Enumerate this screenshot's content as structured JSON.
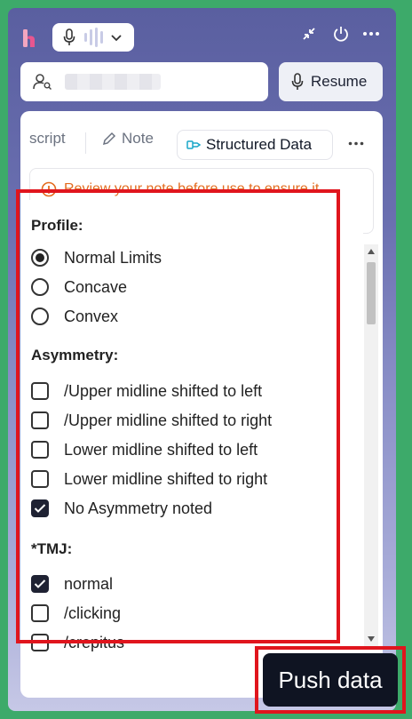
{
  "header": {
    "app_logo": "heidi-logo",
    "mic_icon": "microphone-icon",
    "collapse_icon": "collapse-icon",
    "power_icon": "power-icon",
    "more_icon": "more-horizontal-icon"
  },
  "search": {
    "user_icon": "user-search-icon",
    "value": ""
  },
  "resume_button": {
    "label": "Resume"
  },
  "tabs": {
    "transcript": "script",
    "note": "Note",
    "structured_data": "Structured Data"
  },
  "warning": {
    "text": "Review your note before use to ensure it"
  },
  "form": {
    "profile": {
      "title": "Profile:",
      "options": [
        {
          "label": "Normal Limits",
          "selected": true
        },
        {
          "label": "Concave",
          "selected": false
        },
        {
          "label": "Convex",
          "selected": false
        }
      ]
    },
    "asymmetry": {
      "title": "Asymmetry:",
      "options": [
        {
          "label": "/Upper midline shifted to left",
          "checked": false
        },
        {
          "label": "/Upper midline shifted to right",
          "checked": false
        },
        {
          "label": "Lower midline shifted to left",
          "checked": false
        },
        {
          "label": "Lower midline shifted to right",
          "checked": false
        },
        {
          "label": "No Asymmetry noted",
          "checked": true
        }
      ]
    },
    "tmj": {
      "title": "*TMJ:",
      "options": [
        {
          "label": "normal",
          "checked": true
        },
        {
          "label": "/clicking",
          "checked": false
        },
        {
          "label": "/crepitus",
          "checked": false
        }
      ]
    }
  },
  "push_button": {
    "label": "Push data"
  },
  "colors": {
    "highlight": "#e0151d",
    "warning": "#e36b1e",
    "accent": "#1f2233"
  }
}
